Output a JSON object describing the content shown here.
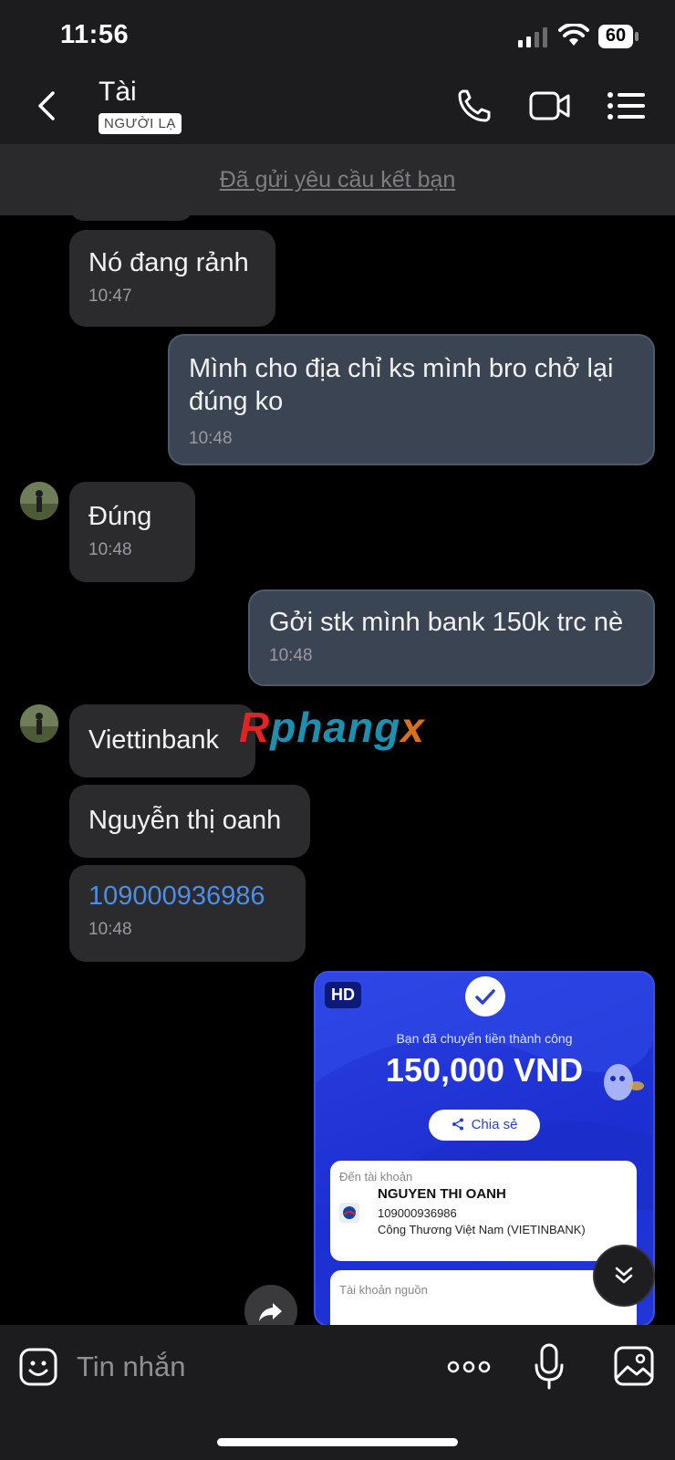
{
  "status_bar": {
    "time": "11:56",
    "battery": "60"
  },
  "header": {
    "contact_name": "Tài",
    "badge": "NGƯỜI LẠ",
    "icons": [
      "back-icon",
      "phone-icon",
      "video-icon",
      "list-icon"
    ]
  },
  "friend_request_text": "Đã gửi yêu cầu kết bạn",
  "messages": [
    {
      "direction": "in",
      "text": "Nó đang rảnh",
      "time": "10:47"
    },
    {
      "direction": "out",
      "text": "Mình cho địa chỉ ks mình bro chở lại đúng ko",
      "time": "10:48"
    },
    {
      "direction": "in",
      "text": "Đúng",
      "time": "10:48"
    },
    {
      "direction": "out",
      "text": "Gởi stk mình bank 150k trc nè",
      "time": "10:48"
    },
    {
      "direction": "in",
      "text": "Viettinbank"
    },
    {
      "direction": "in",
      "text": "Nguyễn thị oanh"
    },
    {
      "direction": "in",
      "text": "109000936986",
      "time": "10:48",
      "is_link": true
    }
  ],
  "watermark": {
    "part1": "R",
    "part2": "phang",
    "part3": "x"
  },
  "image_message": {
    "hd_badge": "HD",
    "success_text": "Bạn đã chuyển tiền thành công",
    "amount": "150,000 VND",
    "share_label": "Chia sẻ",
    "to_account_label": "Đến tài khoản",
    "recipient_name": "NGUYEN THI OANH",
    "account_number": "109000936986",
    "bank_name": "Công Thương Việt Nam (VIETINBANK)",
    "source_account_label": "Tài khoản nguồn"
  },
  "input_bar": {
    "placeholder": "Tin nhắn"
  },
  "colors": {
    "accent_link": "#4b8fe8",
    "outgoing_bubble": "#3a4453",
    "incoming_bubble": "#2b2b2d",
    "bank_blue": "#2236d6"
  }
}
